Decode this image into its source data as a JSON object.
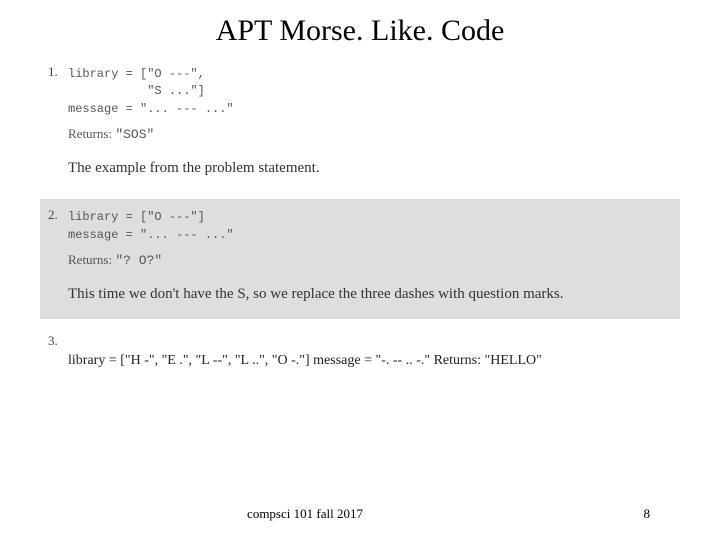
{
  "title": "APT Morse. Like. Code",
  "examples": [
    {
      "num": "1.",
      "code": "library = [\"O ---\",\n           \"S ...\"]\nmessage = \"... --- ...\"",
      "returns_label": "Returns:",
      "returns_value": "\"SOS\"",
      "explain": "The example from the problem statement."
    },
    {
      "num": "2.",
      "code": "library = [\"O ---\"]\nmessage = \"... --- ...\"",
      "returns_label": "Returns:",
      "returns_value": "\"? O?\"",
      "explain": "This time we don't have the S, so we replace the three dashes with question marks."
    },
    {
      "num": "3.",
      "line": "library = [\"H -\", \"E .\", \"L --\", \"L ..\", \"O -.\"] message = \"-. -- .. -.\" Returns: \"HELLO\""
    }
  ],
  "footer_center": "compsci 101  fall 2017",
  "footer_page": "8"
}
